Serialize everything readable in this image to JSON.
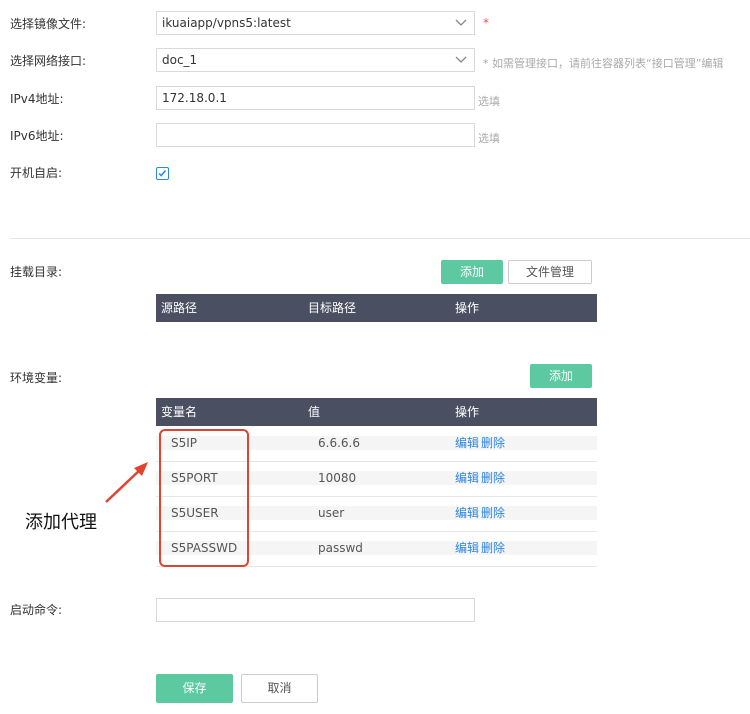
{
  "form": {
    "image": {
      "label": "选择镜像文件:",
      "value": "ikuaiapp/vpns5:latest",
      "required": "*"
    },
    "network": {
      "label": "选择网络接口:",
      "value": "doc_1",
      "hint": "* 如需管理接口，请前往容器列表“接口管理”编辑"
    },
    "ipv4": {
      "label": "IPv4地址:",
      "value": "172.18.0.1",
      "hint": "选填"
    },
    "ipv6": {
      "label": "IPv6地址:",
      "value": "",
      "hint": "选填"
    },
    "autostart": {
      "label": "开机自启:",
      "checked": true
    }
  },
  "mount": {
    "label": "挂载目录:",
    "add_label": "添加",
    "file_manage_label": "文件管理",
    "columns": [
      "源路径",
      "目标路径",
      "操作"
    ]
  },
  "env": {
    "label": "环境变量:",
    "add_label": "添加",
    "columns": [
      "变量名",
      "值",
      "操作"
    ],
    "rows": [
      {
        "name": "S5IP",
        "value": "6.6.6.6",
        "edit": "编辑",
        "delete": "删除"
      },
      {
        "name": "S5PORT",
        "value": "10080",
        "edit": "编辑",
        "delete": "删除"
      },
      {
        "name": "S5USER",
        "value": "user",
        "edit": "编辑",
        "delete": "删除"
      },
      {
        "name": "S5PASSWD",
        "value": "passwd",
        "edit": "编辑",
        "delete": "删除"
      }
    ]
  },
  "startup": {
    "label": "启动命令:",
    "value": ""
  },
  "actions": {
    "save_label": "保存",
    "cancel_label": "取消"
  },
  "annotation": {
    "text": "添加代理"
  },
  "colors": {
    "accent_green": "#5cc9a0",
    "table_header": "#4a4f62",
    "link_blue": "#2e86de",
    "annotation_red": "#e0432f",
    "required_red": "#e05a5a"
  }
}
